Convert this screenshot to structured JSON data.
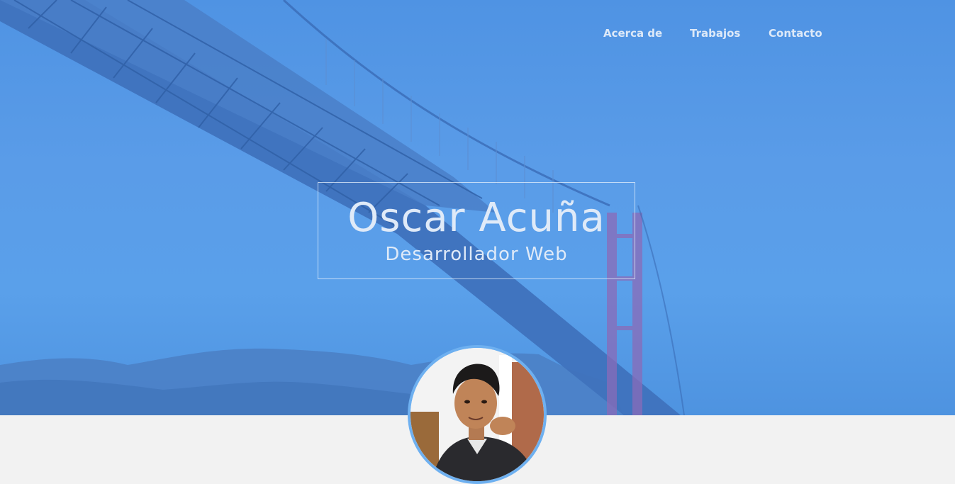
{
  "nav": {
    "items": [
      {
        "label": "Acerca de"
      },
      {
        "label": "Trabajos"
      },
      {
        "label": "Contacto"
      }
    ]
  },
  "hero": {
    "name": "Oscar Acuña",
    "role": "Desarrollador Web"
  },
  "colors": {
    "hero_overlay": "#4f93e3",
    "text_light": "#dfeaf8",
    "page_background": "#f2f2f2",
    "avatar_ring": "#6eb0f0"
  },
  "icons": {
    "background_image": "golden-gate-bridge-photo",
    "avatar_image": "profile-photo"
  }
}
